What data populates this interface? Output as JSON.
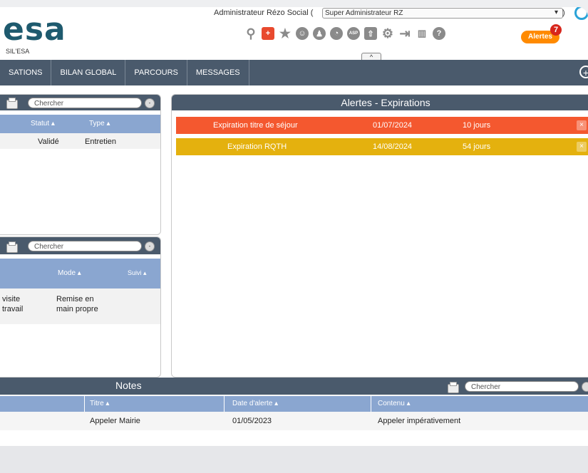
{
  "header": {
    "logo_text": "esa",
    "logo_sub": "SIL'ESA",
    "user_label": "Administrateur Rézo Social (",
    "user_select_value": "Super Administrateur RZ",
    "user_select_close": ")",
    "alert_button": "Alertes",
    "alert_count": "7",
    "collapse_glyph": "^"
  },
  "nav": {
    "items": [
      "SATIONS",
      "BILAN GLOBAL",
      "PARCOURS",
      "MESSAGES"
    ],
    "plus_glyph": "+"
  },
  "left_top": {
    "search_placeholder": "Chercher",
    "columns": [
      "Statut ▴",
      "Type ▴"
    ],
    "rows": [
      [
        "Validé",
        "Entretien"
      ]
    ]
  },
  "left_bottom": {
    "search_placeholder": "Chercher",
    "columns": [
      "Mode ▴",
      "Suivi ▴"
    ],
    "rows": [
      [
        "visite\ntravail",
        "Remise en\nmain propre"
      ]
    ]
  },
  "alerts": {
    "title": "Alertes - Expirations",
    "colors": {
      "red": "#f4582f",
      "yellow": "#e4b10e"
    },
    "rows": [
      {
        "label": "Expiration titre de séjour",
        "date": "01/07/2024",
        "days": "10 jours",
        "close": "×"
      },
      {
        "label": "Expiration RQTH",
        "date": "14/08/2024",
        "days": "54 jours",
        "close": "×"
      }
    ]
  },
  "notes": {
    "title": "Notes",
    "search_placeholder": "Chercher",
    "columns": [
      "Titre ▴",
      "Date d'alerte ▴",
      "Contenu ▴"
    ],
    "rows": [
      [
        "Appeler Mairie",
        "01/05/2023",
        "Appeler impérativement"
      ]
    ]
  },
  "icons": [
    "search-icon",
    "add-icon",
    "star-icon",
    "user-icon",
    "users-icon",
    "chart-icon",
    "asp-icon",
    "upload-icon",
    "gear-icon",
    "logout-icon",
    "stats-icon",
    "help-icon"
  ]
}
